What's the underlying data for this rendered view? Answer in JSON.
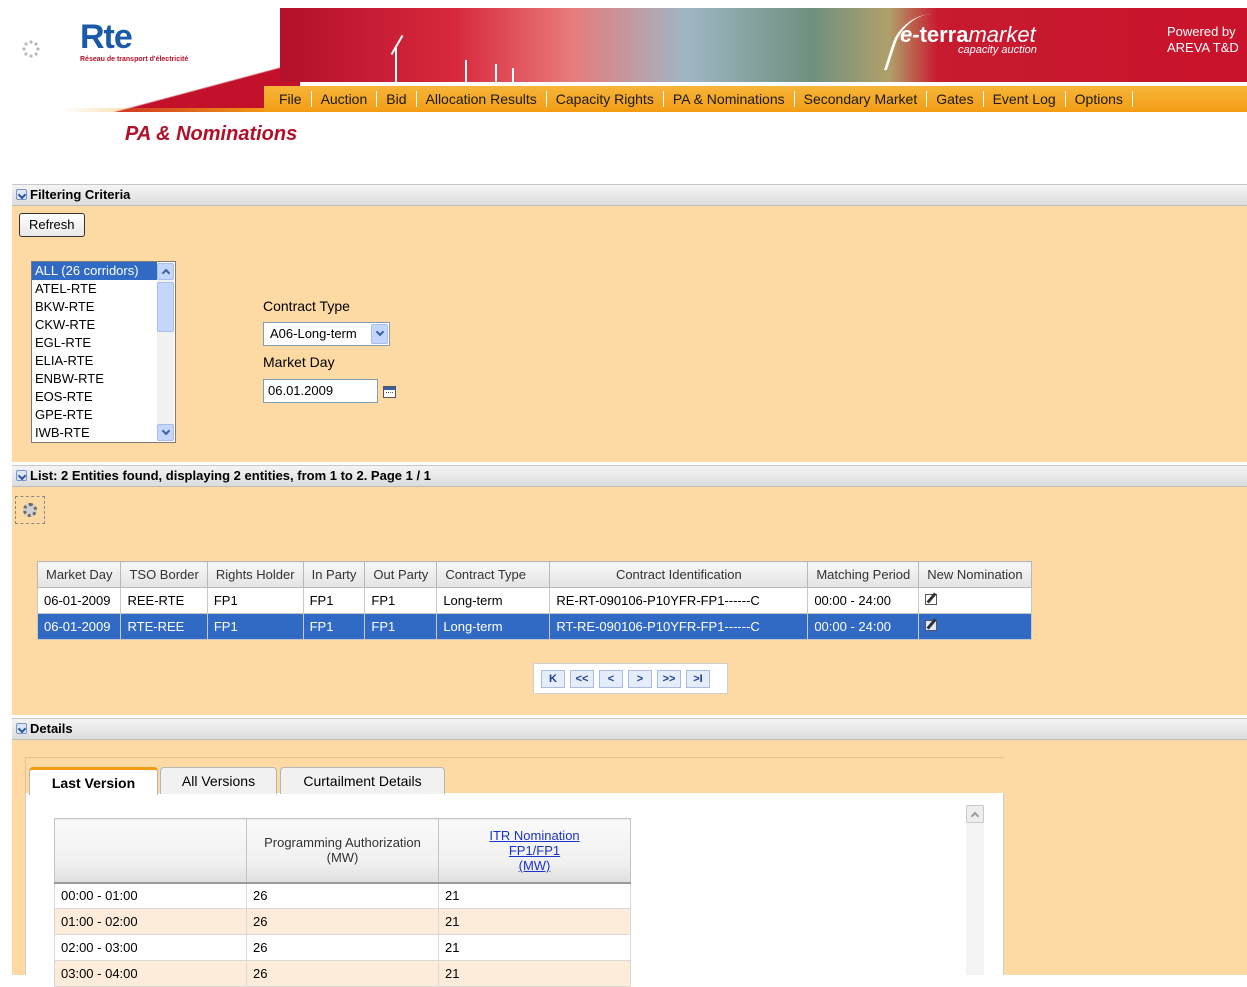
{
  "header": {
    "logo_word": "Rte",
    "logo_sub": "Réseau de transport d'électricité",
    "brand_e": "e-",
    "brand_terra": "terra",
    "brand_market": "market",
    "brand_sub": "capacity auction",
    "powered_line1": "Powered by",
    "powered_line2": "AREVA T&D"
  },
  "menu": [
    "File",
    "Auction",
    "Bid",
    "Allocation Results",
    "Capacity Rights",
    "PA & Nominations",
    "Secondary Market",
    "Gates",
    "Event Log",
    "Options"
  ],
  "page_title": "PA & Nominations",
  "filter": {
    "section_title": "Filtering Criteria",
    "refresh_label": "Refresh",
    "corridors": [
      "ALL (26 corridors)",
      "ATEL-RTE",
      "BKW-RTE",
      "CKW-RTE",
      "EGL-RTE",
      "ELIA-RTE",
      "ENBW-RTE",
      "EOS-RTE",
      "GPE-RTE",
      "IWB-RTE"
    ],
    "contract_type_label": "Contract Type",
    "contract_type_value": "A06-Long-term",
    "market_day_label": "Market Day",
    "market_day_value": "06.01.2009"
  },
  "list": {
    "section_title": "List: 2 Entities found, displaying 2 entities, from 1 to 2. Page 1 / 1",
    "columns": [
      "Market Day",
      "TSO Border",
      "Rights Holder",
      "In Party",
      "Out Party",
      "Contract Type",
      "Contract Identification",
      "Matching Period",
      "New Nomination"
    ],
    "rows": [
      [
        "06-01-2009",
        "REE-RTE",
        "FP1",
        "FP1",
        "FP1",
        "Long-term",
        "RE-RT-090106-P10YFR-FP1------C",
        "00:00 - 24:00"
      ],
      [
        "06-01-2009",
        "RTE-REE",
        "FP1",
        "FP1",
        "FP1",
        "Long-term",
        "RT-RE-090106-P10YFR-FP1------C",
        "00:00 - 24:00"
      ]
    ],
    "pager": [
      "K",
      "<<",
      "<",
      ">",
      ">>",
      ">I"
    ]
  },
  "details": {
    "section_title": "Details",
    "tabs": [
      "Last Version",
      "All Versions",
      "Curtailment Details"
    ],
    "col_pa_line1": "Programming Authorization",
    "col_pa_line2": "(MW)",
    "col_itr_line1": "ITR Nomination",
    "col_itr_line2": "FP1/FP1",
    "col_itr_line3": "(MW)",
    "rows": [
      [
        "00:00 - 01:00",
        "26",
        "21"
      ],
      [
        "01:00 - 02:00",
        "26",
        "21"
      ],
      [
        "02:00 - 03:00",
        "26",
        "21"
      ],
      [
        "03:00 - 04:00",
        "26",
        "21"
      ]
    ]
  }
}
